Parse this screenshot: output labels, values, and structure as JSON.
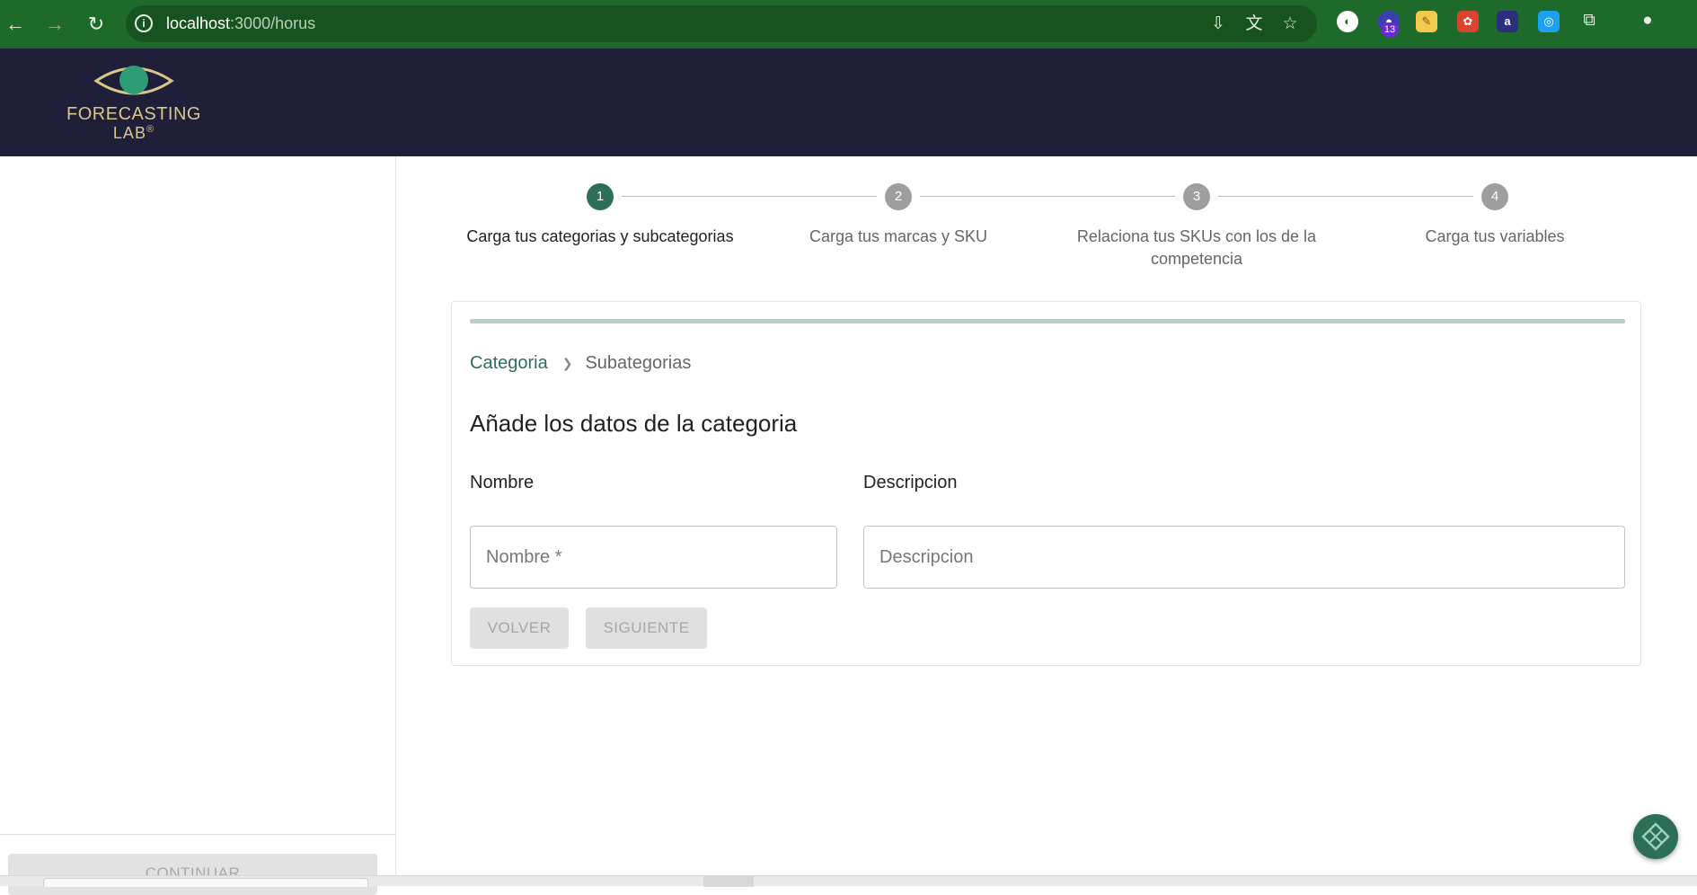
{
  "browser": {
    "url_host": "localhost",
    "url_path": ":3000/horus",
    "extension_badge": "13"
  },
  "app": {
    "logo_line1": "FORECASTING",
    "logo_line2": "LAB",
    "logo_mark": "®"
  },
  "sidebar": {
    "continue_label": "CONTINUAR"
  },
  "stepper": {
    "steps": [
      {
        "number": "1",
        "label": "Carga tus categorias y subcategorias",
        "active": true
      },
      {
        "number": "2",
        "label": "Carga tus marcas y SKU",
        "active": false
      },
      {
        "number": "3",
        "label": "Relaciona tus SKUs con los de la competencia",
        "active": false
      },
      {
        "number": "4",
        "label": "Carga tus variables",
        "active": false
      }
    ]
  },
  "form": {
    "breadcrumb": [
      "Categoria",
      "Subategorias"
    ],
    "title": "Añade los datos de la categoria",
    "name_label": "Nombre",
    "name_placeholder": "Nombre *",
    "description_label": "Descripcion",
    "description_placeholder": "Descripcion",
    "back_label": "VOLVER",
    "next_label": "SIGUIENTE"
  },
  "colors": {
    "browser_frame": "#1e6a2b",
    "app_header": "#201f3a",
    "accent": "#2d6e57",
    "logo_gold": "#d9c78a"
  }
}
